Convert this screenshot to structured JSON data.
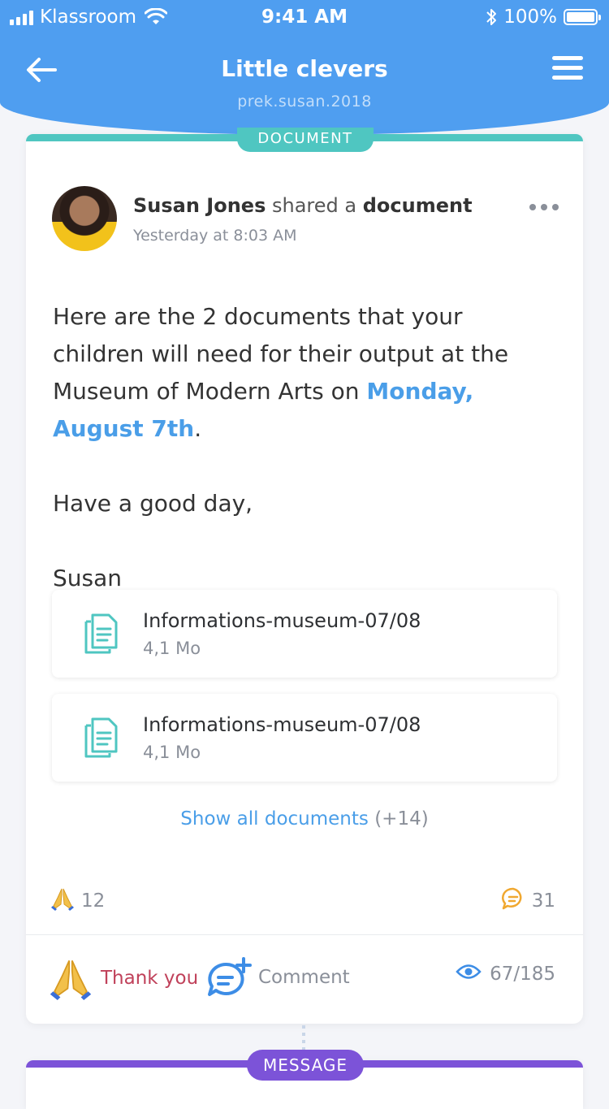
{
  "status_bar": {
    "carrier": "Klassroom",
    "time": "9:41 AM",
    "battery": "100%",
    "battery_level": 1.0
  },
  "header": {
    "title": "Little clevers",
    "subtitle": "prek.susan.2018"
  },
  "post": {
    "badge": "DOCUMENT",
    "author": "Susan Jones",
    "action_text": "shared a",
    "action_object": "document",
    "timestamp": "Yesterday at 8:03 AM",
    "body_part1": "Here are the 2 documents that your children will need for their output at the Museum of Modern Arts on ",
    "body_date": "Monday, August 7th",
    "body_part2": ".",
    "greeting": "Have a good day,",
    "signature": "Susan",
    "files": [
      {
        "name": "Informations-museum-07/08",
        "size": "4,1 Mo"
      },
      {
        "name": "Informations-museum-07/08",
        "size": "4,1 Mo"
      }
    ],
    "show_all_label": "Show all documents",
    "show_all_count": "(+14)",
    "thanks_count": "12",
    "comments_count": "31",
    "actions": {
      "thank_you": "Thank you",
      "comment": "Comment",
      "views": "67/185"
    }
  },
  "next_post": {
    "badge": "MESSAGE"
  },
  "colors": {
    "header_bg": "#4f9ef0",
    "document_accent": "#4fc6c1",
    "message_accent": "#7c53d8",
    "link": "#4a9ee8",
    "thank_you_text": "#c0415a",
    "comment_icon": "#f0a830"
  },
  "icons": {
    "back": "arrow-left-icon",
    "menu": "hamburger-menu-icon",
    "more": "more-dots-icon",
    "file": "document-icon",
    "thanks": "praying-hands-icon",
    "comments": "speech-bubble-icon",
    "add_comment": "add-comment-icon",
    "views": "eye-icon"
  }
}
